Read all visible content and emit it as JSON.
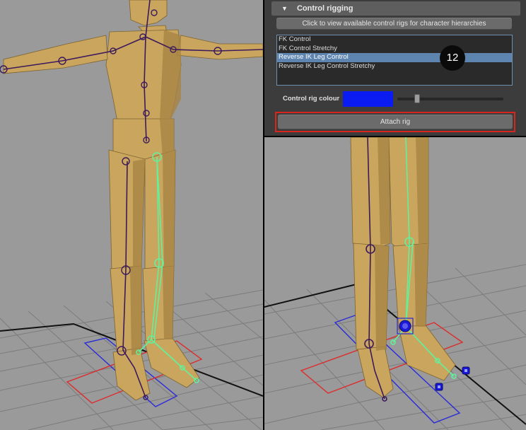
{
  "panel": {
    "section_title": "Control rigging",
    "view_rigs_button": "Click to view available control rigs for character hierarchies",
    "rig_options": [
      "FK Control",
      "FK Control Stretchy",
      "Reverse IK Leg Control",
      "Reverse IK Leg Control Stretchy"
    ],
    "selected_rig_index": 2,
    "colour_label": "Control rig colour",
    "colour_value": "#0b1cf2",
    "attach_button": "Attach rig"
  },
  "step_marker": "12",
  "colors": {
    "viewport_background": "#9a9a9a",
    "skin": "#c9a55e",
    "bone": "#3c1a5c",
    "ik_bone": "#64f09b",
    "selected_item": "#5e85b0",
    "highlight_border": "#d8261f"
  }
}
